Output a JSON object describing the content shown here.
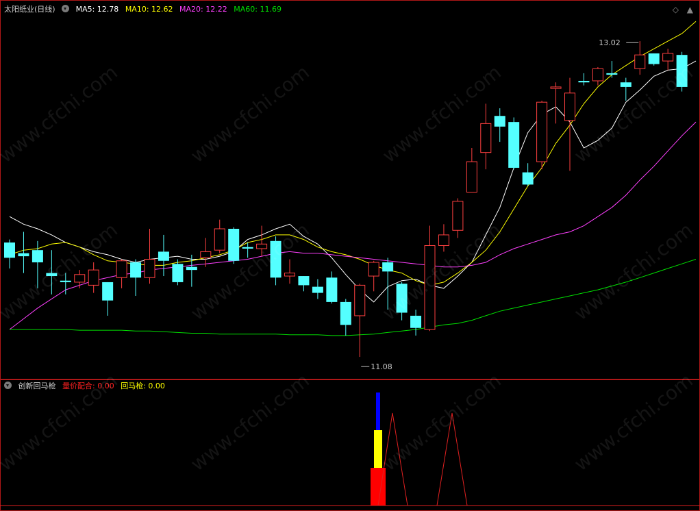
{
  "main_panel": {
    "title": "太阳纸业(日线)",
    "indicators": [
      {
        "label": "MA5: 12.78",
        "color": "#ffffff"
      },
      {
        "label": "MA10: 12.62",
        "color": "#ffff00"
      },
      {
        "label": "MA20: 12.22",
        "color": "#ff40ff"
      },
      {
        "label": "MA60: 11.69",
        "color": "#00e000"
      }
    ],
    "high_marker": "13.02",
    "low_marker": "11.08"
  },
  "sub_panel": {
    "name": "创新回马枪",
    "item1_label": "量价配合: 0.00",
    "item2_label": "回马枪: 0.00"
  },
  "watermark": "www.cfchi.com",
  "colors": {
    "up": "#ff4040",
    "down": "#54ffff",
    "border": "#b01818",
    "ma5": "#ffffff",
    "ma10": "#ffff00",
    "ma20": "#ff40ff",
    "ma60": "#00e000"
  },
  "chart_data": [
    {
      "type": "candlestick",
      "series": [
        {
          "name": "MA5",
          "values": [
            12.0,
            11.95,
            11.92,
            11.88,
            11.83,
            11.8,
            11.77,
            11.75,
            11.72,
            11.7,
            11.72,
            11.73,
            11.74,
            11.72,
            11.72,
            11.74,
            11.77,
            11.85,
            11.88,
            11.92,
            11.95,
            11.87,
            11.82,
            11.73,
            11.62,
            11.52,
            11.44,
            11.54,
            11.58,
            11.59,
            11.55,
            11.53,
            11.61,
            11.7,
            11.88,
            12.06,
            12.32,
            12.55,
            12.67,
            12.72,
            12.62,
            12.45,
            12.5,
            12.58,
            12.75,
            12.83,
            12.92,
            12.96,
            12.97,
            13.02
          ]
        },
        {
          "name": "MA10",
          "values": [
            11.75,
            11.78,
            11.79,
            11.82,
            11.83,
            11.8,
            11.75,
            11.71,
            11.7,
            11.69,
            11.68,
            11.68,
            11.7,
            11.71,
            11.73,
            11.75,
            11.78,
            11.83,
            11.85,
            11.88,
            11.88,
            11.85,
            11.8,
            11.77,
            11.75,
            11.72,
            11.68,
            11.65,
            11.63,
            11.58,
            11.55,
            11.57,
            11.63,
            11.7,
            11.78,
            11.9,
            12.05,
            12.2,
            12.32,
            12.48,
            12.6,
            12.74,
            12.85,
            12.93,
            12.99,
            13.05,
            13.1,
            13.15,
            13.2,
            13.28
          ]
        },
        {
          "name": "MA20",
          "values": [
            11.26,
            11.33,
            11.4,
            11.46,
            11.52,
            11.55,
            11.58,
            11.6,
            11.62,
            11.63,
            11.65,
            11.66,
            11.67,
            11.68,
            11.69,
            11.7,
            11.71,
            11.72,
            11.74,
            11.76,
            11.77,
            11.76,
            11.76,
            11.75,
            11.74,
            11.73,
            11.72,
            11.71,
            11.7,
            11.69,
            11.68,
            11.67,
            11.67,
            11.68,
            11.7,
            11.75,
            11.79,
            11.82,
            11.85,
            11.88,
            11.9,
            11.94,
            12.0,
            12.06,
            12.14,
            12.24,
            12.33,
            12.43,
            12.53,
            12.62
          ]
        },
        {
          "name": "MA60",
          "values": [
            11.26,
            11.26,
            11.26,
            11.26,
            11.26,
            11.255,
            11.255,
            11.255,
            11.255,
            11.25,
            11.25,
            11.245,
            11.24,
            11.235,
            11.235,
            11.23,
            11.23,
            11.23,
            11.23,
            11.23,
            11.225,
            11.225,
            11.225,
            11.22,
            11.22,
            11.225,
            11.23,
            11.24,
            11.25,
            11.26,
            11.275,
            11.29,
            11.3,
            11.32,
            11.35,
            11.38,
            11.4,
            11.42,
            11.44,
            11.46,
            11.48,
            11.5,
            11.52,
            11.545,
            11.57,
            11.6,
            11.63,
            11.66,
            11.69,
            11.72
          ]
        }
      ],
      "candles": [
        [
          11.83,
          11.73,
          11.85,
          11.66
        ],
        [
          11.76,
          11.74,
          11.9,
          11.63
        ],
        [
          11.78,
          11.7,
          11.84,
          11.53
        ],
        [
          11.63,
          11.61,
          11.78,
          11.49
        ],
        [
          11.58,
          11.57,
          11.63,
          11.49
        ],
        [
          11.57,
          11.62,
          11.65,
          11.53
        ],
        [
          11.55,
          11.65,
          11.7,
          11.5
        ],
        [
          11.57,
          11.45,
          11.57,
          11.35
        ],
        [
          11.6,
          11.71,
          11.72,
          11.53
        ],
        [
          11.7,
          11.6,
          11.72,
          11.48
        ],
        [
          11.6,
          11.72,
          11.92,
          11.56
        ],
        [
          11.77,
          11.71,
          11.88,
          11.61
        ],
        [
          11.69,
          11.57,
          11.72,
          11.55
        ],
        [
          11.67,
          11.65,
          11.75,
          11.54
        ],
        [
          11.73,
          11.77,
          11.86,
          11.67
        ],
        [
          11.78,
          11.92,
          11.98,
          11.76
        ],
        [
          11.92,
          11.71,
          11.93,
          11.69
        ],
        [
          11.8,
          11.79,
          11.83,
          11.73
        ],
        [
          11.79,
          11.82,
          11.94,
          11.74
        ],
        [
          11.84,
          11.6,
          11.87,
          11.55
        ],
        [
          11.61,
          11.63,
          11.72,
          11.56
        ],
        [
          11.61,
          11.55,
          11.61,
          11.51
        ],
        [
          11.54,
          11.5,
          11.59,
          11.46
        ],
        [
          11.6,
          11.44,
          11.64,
          11.43
        ],
        [
          11.44,
          11.29,
          11.46,
          11.22
        ],
        [
          11.35,
          11.55,
          11.56,
          11.08
        ],
        [
          11.61,
          11.7,
          11.71,
          11.51
        ],
        [
          11.7,
          11.64,
          11.73,
          11.39
        ],
        [
          11.56,
          11.37,
          11.57,
          11.32
        ],
        [
          11.35,
          11.27,
          11.39,
          11.22
        ],
        [
          11.26,
          11.81,
          11.94,
          11.25
        ],
        [
          11.81,
          11.88,
          11.95,
          11.77
        ],
        [
          11.91,
          12.1,
          12.12,
          11.86
        ],
        [
          12.16,
          12.36,
          12.45,
          12.16
        ],
        [
          12.42,
          12.61,
          12.74,
          12.31
        ],
        [
          12.66,
          12.59,
          12.71,
          12.49
        ],
        [
          12.62,
          12.32,
          12.65,
          12.31
        ],
        [
          12.29,
          12.21,
          12.35,
          12.2
        ],
        [
          12.36,
          12.75,
          12.76,
          12.31
        ],
        [
          12.84,
          12.85,
          12.88,
          12.61
        ],
        [
          12.63,
          12.81,
          12.91,
          12.3
        ],
        [
          12.89,
          12.88,
          12.94,
          12.86
        ],
        [
          12.89,
          12.97,
          12.98,
          12.86
        ],
        [
          12.94,
          12.93,
          13.02,
          12.91
        ],
        [
          12.88,
          12.85,
          12.91,
          12.76
        ],
        [
          12.97,
          13.06,
          13.15,
          12.93
        ],
        [
          13.07,
          13.0,
          13.07,
          12.99
        ],
        [
          13.02,
          13.07,
          13.1,
          12.96
        ],
        [
          13.06,
          12.85,
          13.08,
          12.82
        ]
      ]
    },
    {
      "type": "bar",
      "series": [
        {
          "name": "量价配合",
          "color": "#ff0000",
          "values": [
            55
          ]
        },
        {
          "name": "回马枪",
          "color": "#ffff00",
          "values": [
            55
          ]
        }
      ],
      "stacked_top": {
        "color": "#0000ff",
        "value": 55
      }
    }
  ]
}
